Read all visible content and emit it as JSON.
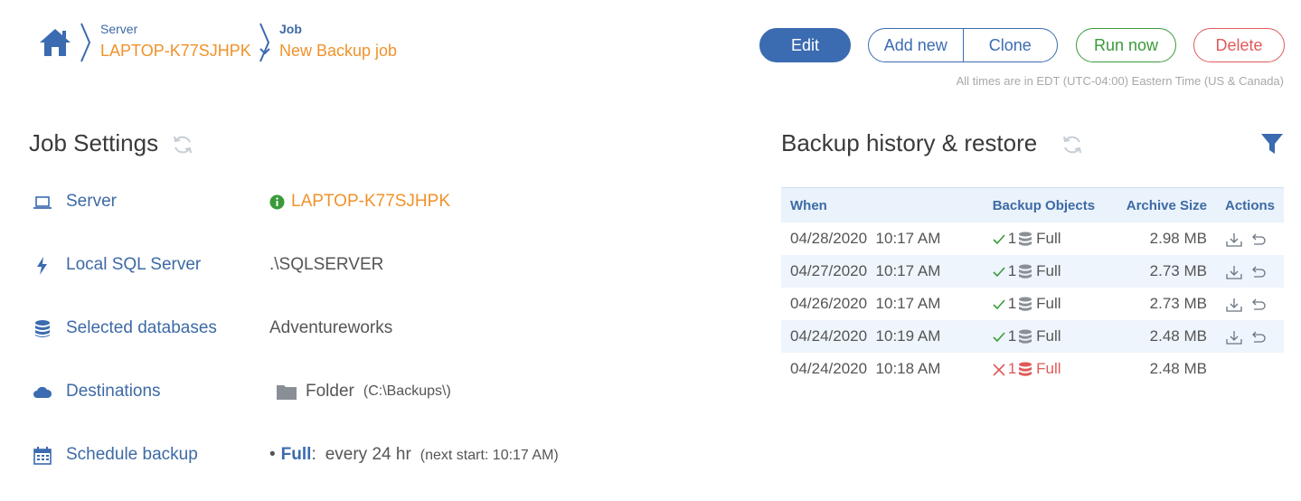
{
  "breadcrumb": {
    "server_label": "Server",
    "server_value": "LAPTOP-K77SJHPK",
    "job_label": "Job",
    "job_value": "New Backup job"
  },
  "toolbar": {
    "edit": "Edit",
    "add_new": "Add new",
    "clone": "Clone",
    "run_now": "Run now",
    "delete": "Delete"
  },
  "timezone_note": "All times are in EDT (UTC-04:00) Eastern Time (US & Canada)",
  "job_settings": {
    "title": "Job Settings",
    "rows": [
      {
        "label": "Server",
        "value": "LAPTOP-K77SJHPK",
        "icon": "laptop-icon"
      },
      {
        "label": "Local SQL Server",
        "value": ".\\SQLSERVER",
        "icon": "bolt-icon"
      },
      {
        "label": "Selected databases",
        "value": "Adventureworks",
        "icon": "database-icon"
      },
      {
        "label": "Destinations",
        "value": "Folder",
        "value_detail": "(C:\\Backups\\)",
        "icon": "cloud-icon"
      },
      {
        "label": "Schedule backup",
        "value_strong": "Full",
        "value": "every 24 hr",
        "value_detail": "(next start: 10:17 AM)",
        "icon": "calendar-icon"
      }
    ]
  },
  "history": {
    "title": "Backup history & restore",
    "columns": [
      "When",
      "Backup Objects",
      "Archive Size",
      "Actions"
    ],
    "rows": [
      {
        "when": "04/28/2020  10:17 AM",
        "count": "1",
        "type": "Full",
        "size": "2.98 MB",
        "status": "ok"
      },
      {
        "when": "04/27/2020  10:17 AM",
        "count": "1",
        "type": "Full",
        "size": "2.73 MB",
        "status": "ok"
      },
      {
        "when": "04/26/2020  10:17 AM",
        "count": "1",
        "type": "Full",
        "size": "2.73 MB",
        "status": "ok"
      },
      {
        "when": "04/24/2020  10:19 AM",
        "count": "1",
        "type": "Full",
        "size": "2.48 MB",
        "status": "ok"
      },
      {
        "when": "04/24/2020  10:18 AM",
        "count": "1",
        "type": "Full",
        "size": "2.48 MB",
        "status": "failed"
      }
    ]
  },
  "colors": {
    "primary": "#3b6bb0",
    "accent_orange": "#f0922b",
    "success": "#3a9a3a",
    "danger": "#e05a5a",
    "table_header_bg": "#eaf2fb"
  }
}
